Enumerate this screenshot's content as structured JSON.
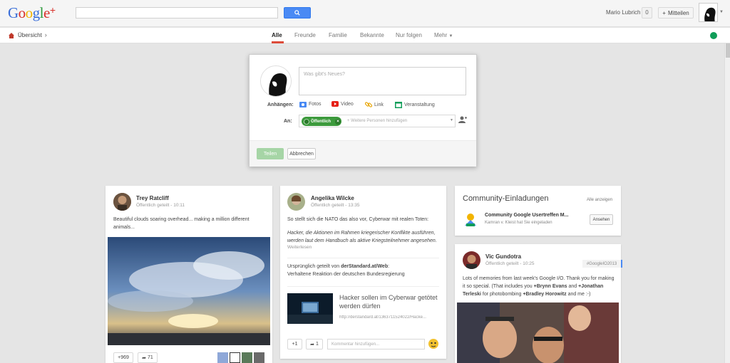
{
  "header": {
    "logo": {
      "g1": "G",
      "o1": "o",
      "o2": "o",
      "g2": "g",
      "l": "l",
      "e": "e",
      "plus": "+"
    },
    "user_name": "Mario Lubrich",
    "notifications": "0",
    "share_label": "Mitteilen"
  },
  "nav": {
    "overview": "Übersicht",
    "tabs": [
      "Alle",
      "Freunde",
      "Familie",
      "Bekannte",
      "Nur folgen",
      "Mehr"
    ]
  },
  "composer": {
    "placeholder": "Was gibt's Neues?",
    "attach_label": "Anhängen:",
    "attachments": [
      "Fotos",
      "Video",
      "Link",
      "Veranstaltung"
    ],
    "to_label": "An:",
    "chip": "Öffentlich",
    "to_placeholder": "+ Weitere Personen hinzufügen",
    "post": "Teilen",
    "cancel": "Abbrechen"
  },
  "post1": {
    "name": "Trey Ratcliff",
    "meta": "Öffentlich geteilt  -  10:11",
    "text": "Beautiful clouds soaring overhead... making a million different animals...",
    "plus": "+969",
    "shares": "71"
  },
  "post2": {
    "name": "Angelika Wilcke",
    "meta": "Öffentlich geteilt  -  13:35",
    "text1": "So stellt sich die NATO das also vor, Cyberwar mit realen Toten:",
    "quote": "Hacker, die Aktionen im Rahmen kriegerischer Konflikte ausführen, werden laut dem Handbuch als aktive Kriegsteilnehmer angesehen.",
    "read_more": "Weiterlesen",
    "orig_prefix": "Ursprünglich geteilt von",
    "orig_source": "derStandard.at/Web",
    "orig_suffix": ":",
    "orig_text": "Verhaltene Reaktion der deutschen Bundesregierung",
    "link_title": "Hacker sollen im Cyberwar getötet werden dürfen",
    "link_url": "http://derstandard.at/1363711524022/Hacke...",
    "plus": "+1",
    "shares": "1",
    "comment_placeholder": "Kommentar hinzufügen..."
  },
  "community": {
    "title": "Community-Einladungen",
    "view_all": "Alle anzeigen",
    "name": "Community Google Usertreffen M...",
    "sub": "Kamran v. Kleist hat Sie eingeladen",
    "view_btn": "Ansehen"
  },
  "post3": {
    "name": "Vic Gundotra",
    "meta": "Öffentlich geteilt  -  10:25",
    "tag": "#GoogleIO2013",
    "text": "Lots of memories from last week's Google I/O. Thank you for making it so special. (That includes you",
    "m1": "+Brynn Evans",
    "and": "and",
    "m2": "+Jonathan Terleski",
    "for": "for photobombing",
    "m3": "+Bradley Horowitz",
    "end": "and me :-)"
  }
}
